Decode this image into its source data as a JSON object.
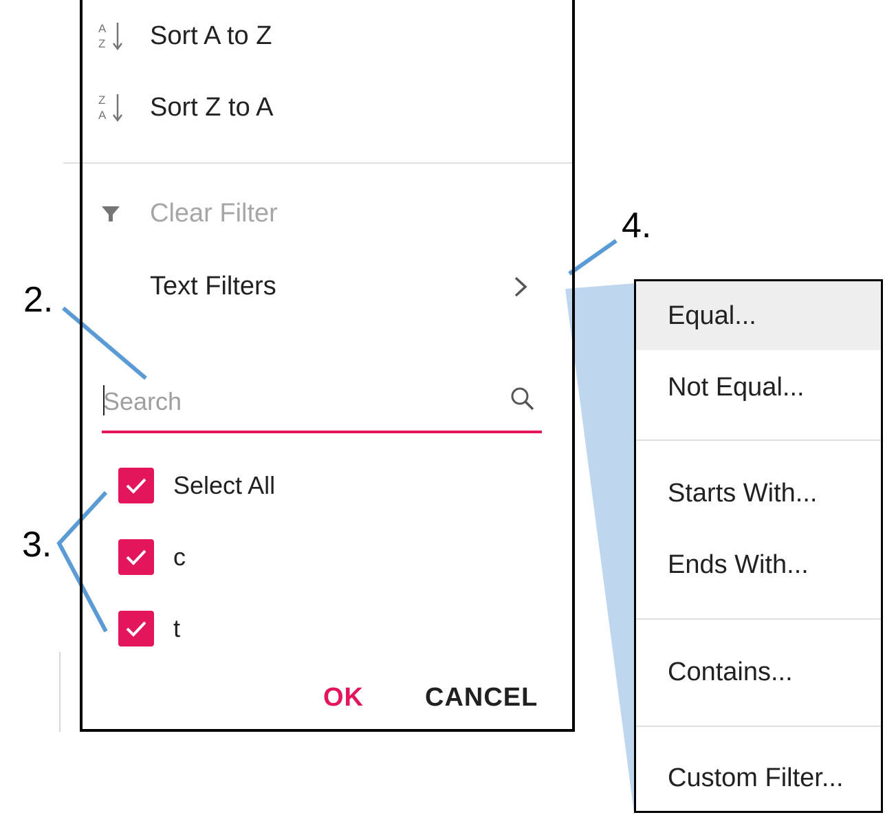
{
  "menu": {
    "sort_asc": "Sort A to Z",
    "sort_desc": "Sort Z to A",
    "clear_filter": "Clear Filter",
    "text_filters": "Text Filters",
    "sort_asc_icon": "sort-ascending-icon",
    "sort_desc_icon": "sort-descending-icon",
    "filter_icon": "filter-icon",
    "chevron_icon": "chevron-right-icon"
  },
  "search": {
    "placeholder": "Search",
    "value": "",
    "icon": "search-icon"
  },
  "checklist": [
    {
      "label": "Select All",
      "checked": true
    },
    {
      "label": "c",
      "checked": true
    },
    {
      "label": "t",
      "checked": true
    }
  ],
  "footer": {
    "ok": "OK",
    "cancel": "CANCEL"
  },
  "submenu": [
    "Equal...",
    "Not Equal...",
    "Starts With...",
    "Ends With...",
    "Contains...",
    "Custom Filter..."
  ],
  "callouts": {
    "c2": "2.",
    "c3": "3.",
    "c4": "4."
  },
  "colors": {
    "accent": "#e3165b",
    "callout_line": "#5b9bd5",
    "submenu_highlight": "#eeeeee"
  }
}
